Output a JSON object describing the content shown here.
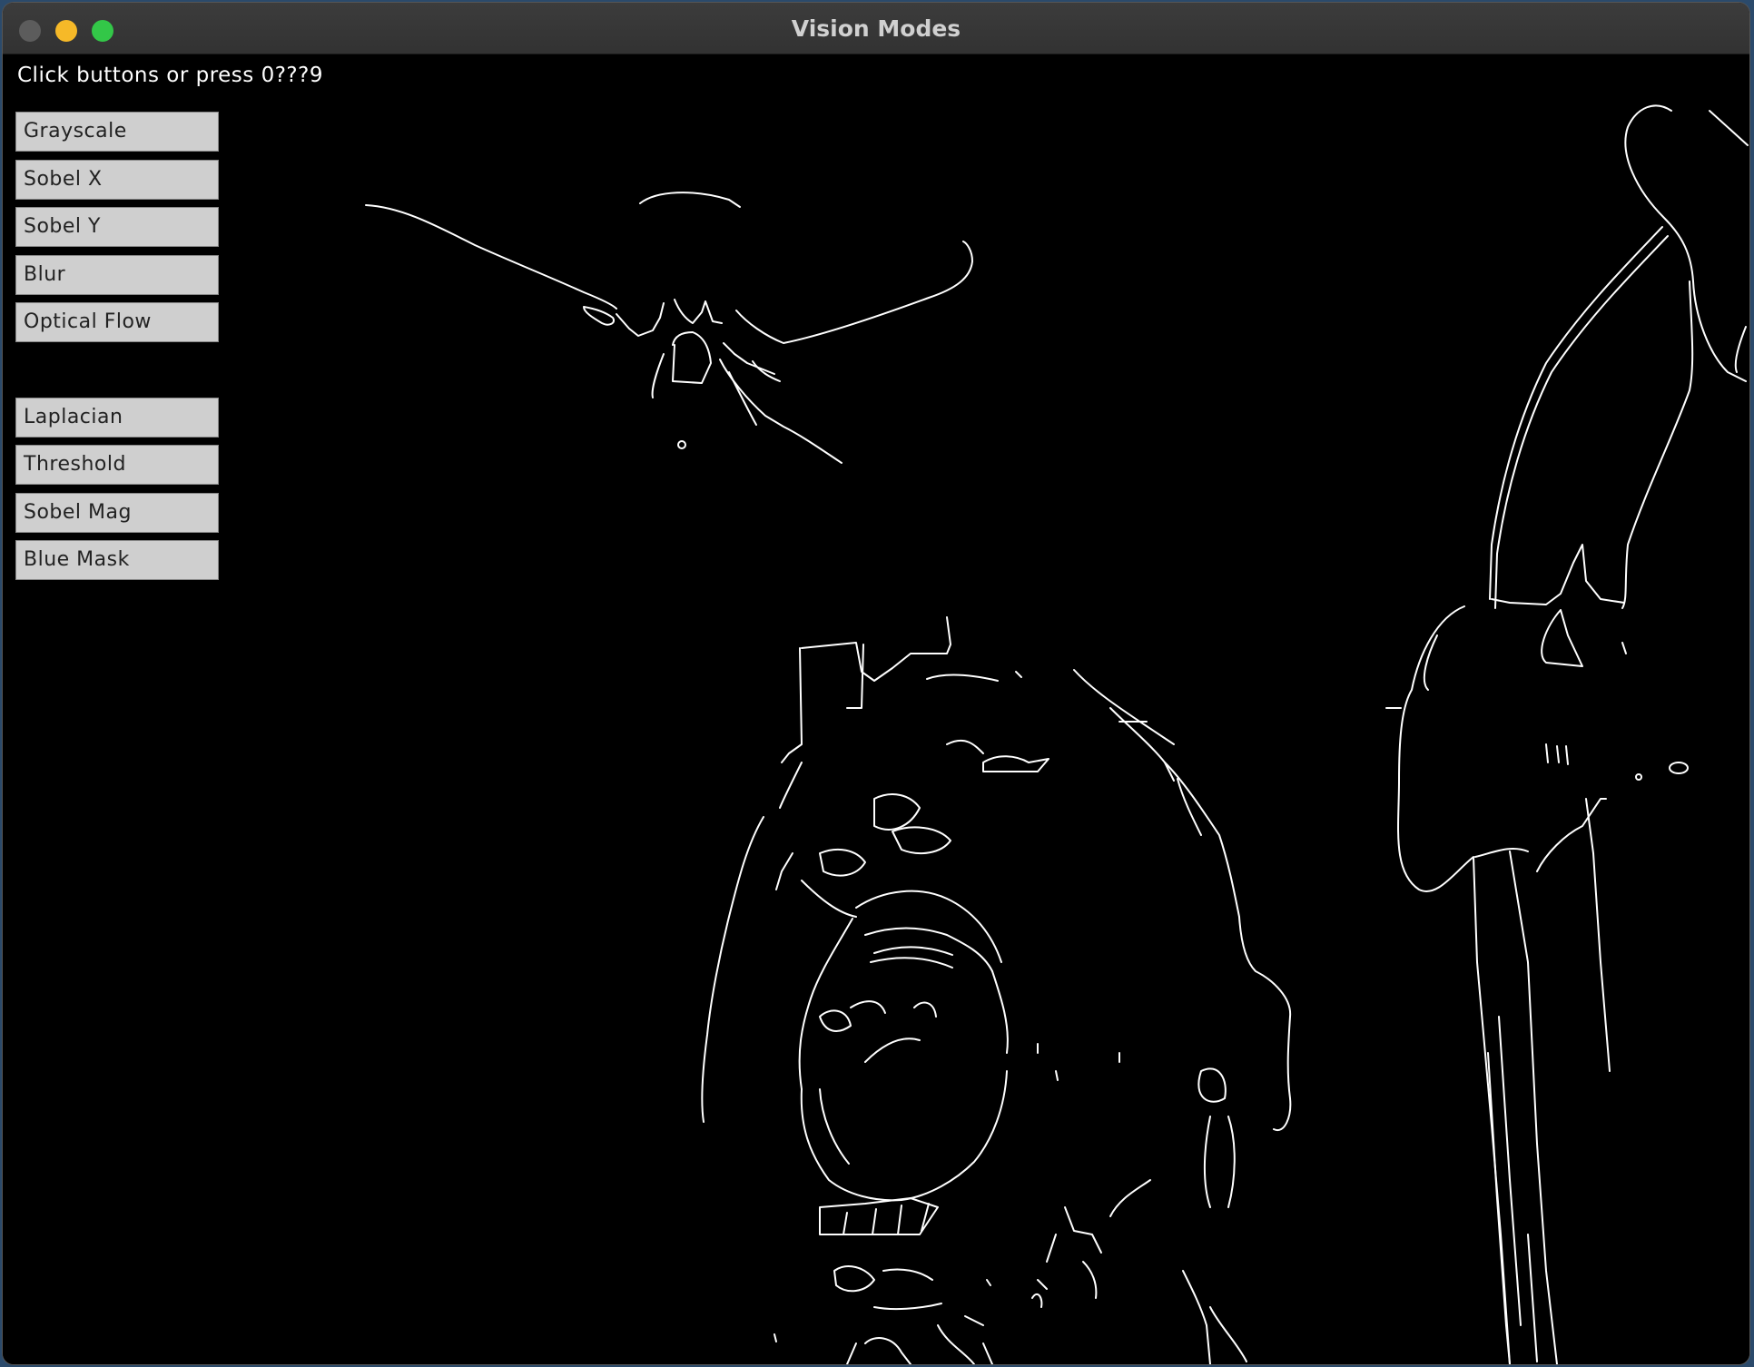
{
  "window": {
    "title": "Vision Modes"
  },
  "hint_text": "Click buttons or press 0???9",
  "buttons": [
    {
      "label": "Grayscale"
    },
    {
      "label": "Sobel X"
    },
    {
      "label": "Sobel Y"
    },
    {
      "label": "Blur"
    },
    {
      "label": "Optical Flow"
    },
    {
      "label": "Laplacian"
    },
    {
      "label": "Threshold"
    },
    {
      "label": "Sobel Mag"
    },
    {
      "label": "Blue Mask"
    }
  ],
  "colors": {
    "close": "#5c5c5c",
    "minimize": "#f6b928",
    "maximize": "#33c748",
    "canvas": "#000000",
    "edges": "#ffffff",
    "button": "#cfcfcf"
  }
}
